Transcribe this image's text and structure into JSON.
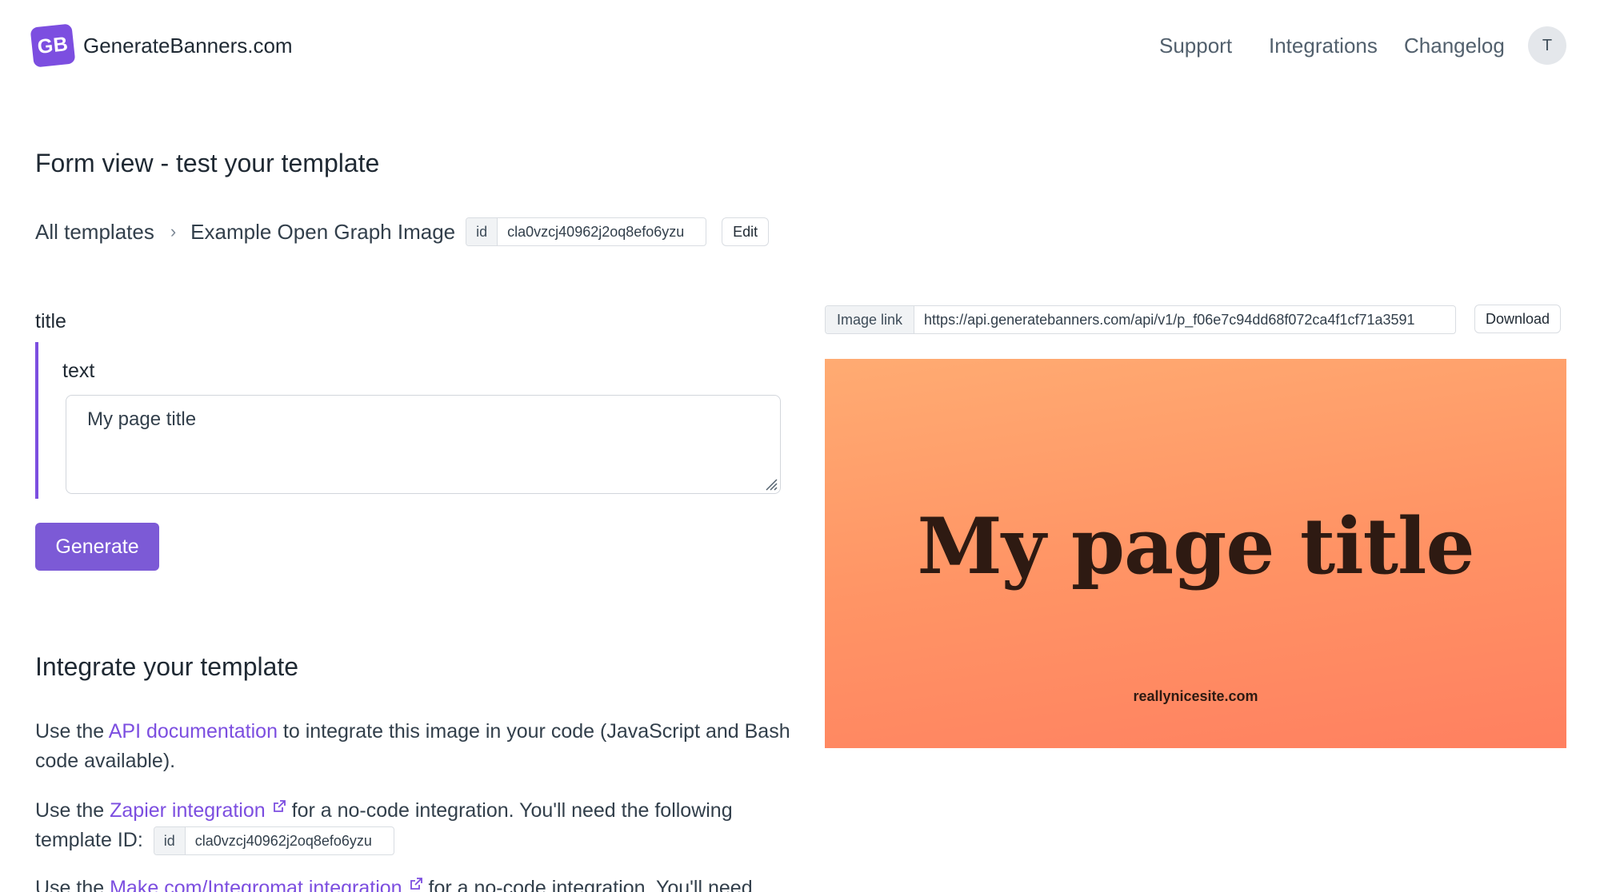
{
  "header": {
    "logo_mark": "GB",
    "logo_text": "GenerateBanners.com",
    "nav": [
      "Support",
      "Integrations",
      "Changelog"
    ],
    "avatar_initial": "T"
  },
  "page_title": "Form view - test your template",
  "breadcrumb": {
    "all_templates": "All templates",
    "separator": "›",
    "template_name": "Example Open Graph Image",
    "id_tag": "id",
    "template_id": "cla0vzcj40962j2oq8efo6yzu",
    "edit_label": "Edit"
  },
  "form": {
    "field_label": "title",
    "sub_label": "text",
    "text_value": "My page title",
    "generate_label": "Generate"
  },
  "integrate": {
    "title": "Integrate your template",
    "api_prefix": "Use the ",
    "api_link": "API documentation",
    "api_suffix": " to integrate this image in your code (JavaScript and Bash code available).",
    "zapier_prefix": "Use the ",
    "zapier_link": "Zapier integration",
    "zapier_suffix": " for a no-code integration. You'll need the following template ID:",
    "id_tag": "id",
    "template_id": "cla0vzcj40962j2oq8efo6yzu",
    "make_prefix": "Use the ",
    "make_link": "Make.com/Integromat integration",
    "make_suffix": " for a no-code integration. You'll need"
  },
  "image_link": {
    "tag": "Image link",
    "url": "https://api.generatebanners.com/api/v1/p_f06e7c94dd68f072ca4f1cf71a3591",
    "download_label": "Download"
  },
  "preview": {
    "title": "My page title",
    "site": "reallynicesite.com"
  },
  "colors": {
    "accent": "#7c4ee0",
    "preview_top": "#ffab72",
    "preview_bottom": "#ff8060"
  },
  "icons": [
    "external-link-icon",
    "chevron-right-icon",
    "resize-grip-icon"
  ]
}
